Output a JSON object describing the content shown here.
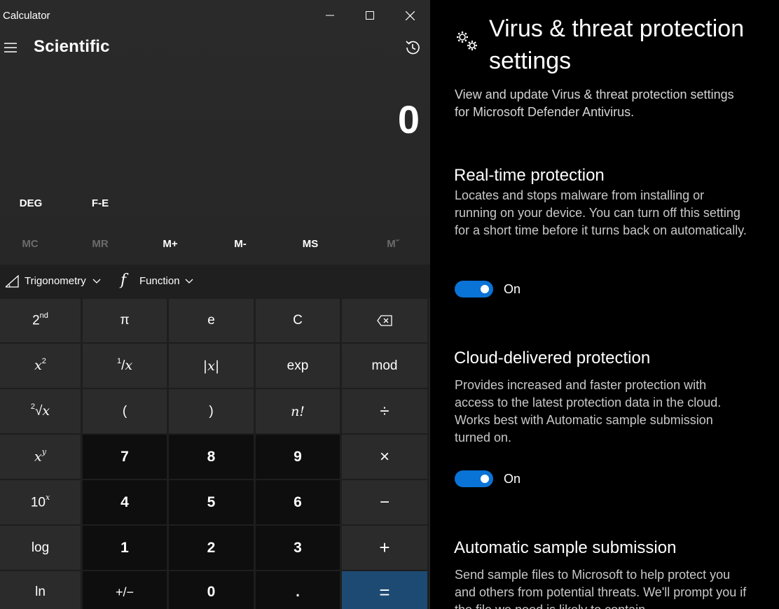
{
  "calculator": {
    "app_title": "Calculator",
    "mode": "Scientific",
    "display": "0",
    "mode_buttons": [
      "DEG",
      "F-E"
    ],
    "memory": {
      "mc": "MC",
      "mr": "MR",
      "mplus": "M+",
      "mminus": "M-",
      "ms": "MS",
      "mlist": "Mˇ"
    },
    "function_row": {
      "trig": "Trigonometry",
      "func": "Function",
      "func_glyph": "f"
    },
    "keys": {
      "backspace": "⌫",
      "pi": "π",
      "e": "e",
      "clear": "C",
      "abs": "|x|",
      "exp": "exp",
      "mod": "mod",
      "lparen": "(",
      "rparen": ")",
      "fact": "n!",
      "divide": "÷",
      "seven": "7",
      "eight": "8",
      "nine": "9",
      "multiply": "×",
      "four": "4",
      "five": "5",
      "six": "6",
      "minus": "−",
      "log": "log",
      "one": "1",
      "two": "2",
      "three": "3",
      "plus": "+",
      "ln": "ln",
      "negate": "+/−",
      "zero": "0",
      "decimal": ".",
      "equals": "="
    }
  },
  "defender": {
    "title": "Virus & threat protection settings",
    "subtitle": "View and update Virus & threat protection settings for Microsoft Defender Antivirus.",
    "sections": [
      {
        "title": "Real-time protection",
        "desc": "Locates and stops malware from installing or running on your device. You can turn off this setting for a short time before it turns back on automatically.",
        "toggle_state": "On"
      },
      {
        "title": "Cloud-delivered protection",
        "desc": "Provides increased and faster protection with access to the latest protection data in the cloud. Works best with Automatic sample submission turned on.",
        "toggle_state": "On"
      },
      {
        "title": "Automatic sample submission",
        "desc": "Send sample files to Microsoft to help protect you and others from potential threats. We'll prompt you if the file we need is likely to contain"
      }
    ],
    "accent_color": "#0a73d6"
  }
}
